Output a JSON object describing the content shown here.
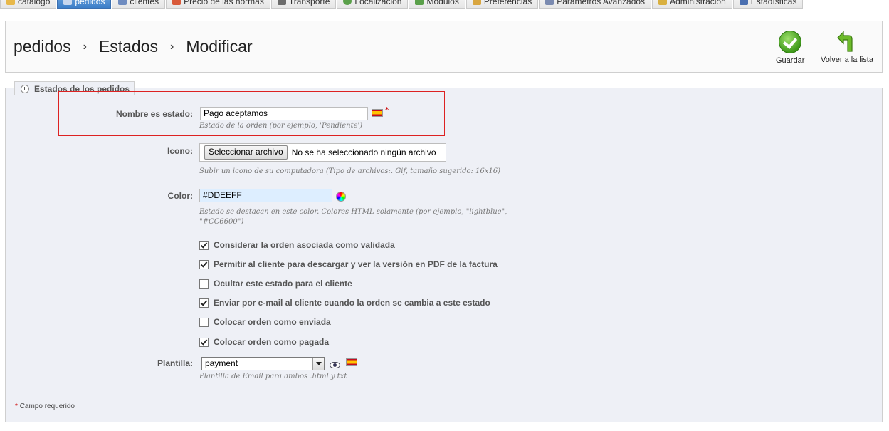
{
  "tabs": [
    {
      "label": "catálogo",
      "icon": "folder-icon",
      "color": "#e8b84a",
      "active": false
    },
    {
      "label": "pedidos",
      "icon": "cart-icon",
      "color": "#c8d7ee",
      "active": true
    },
    {
      "label": "clientes",
      "icon": "users-icon",
      "color": "#6f8cc0",
      "active": false
    },
    {
      "label": "Precio de las normas",
      "icon": "price-tag-icon",
      "color": "#d95a3a",
      "active": false
    },
    {
      "label": "Transporte",
      "icon": "truck-icon",
      "color": "#6b6b6b",
      "active": false
    },
    {
      "label": "Localización",
      "icon": "globe-icon",
      "color": "#5aa04a",
      "active": false
    },
    {
      "label": "Módulos",
      "icon": "puzzle-icon",
      "color": "#5aa04a",
      "active": false
    },
    {
      "label": "Preferencias",
      "icon": "preferences-icon",
      "color": "#d9a640",
      "active": false
    },
    {
      "label": "Parámetros Avanzados",
      "icon": "wrench-icon",
      "color": "#7a8ab0",
      "active": false
    },
    {
      "label": "Administración",
      "icon": "key-icon",
      "color": "#d9b040",
      "active": false
    },
    {
      "label": "Estadísticas",
      "icon": "stats-icon",
      "color": "#4a6fb0",
      "active": false
    }
  ],
  "breadcrumb": {
    "items": [
      "pedidos",
      "Estados",
      "Modificar"
    ],
    "separator": "›"
  },
  "toolbar": {
    "save_label": "Guardar",
    "back_label": "Volver a la lista"
  },
  "form": {
    "legend": "Estados de los pedidos",
    "name": {
      "label": "Nombre es estado:",
      "value": "Pago aceptamos",
      "required_mark": "*",
      "hint": "Estado de la orden (por ejemplo, 'Pendiente')"
    },
    "icon": {
      "label": "Icono:",
      "button_label": "Seleccionar archivo",
      "file_status": "No se ha seleccionado ningún archivo",
      "hint": "Subir un icono de su computadora (Tipo de archivos:. Gif, tamaño sugerido: 16x16)"
    },
    "color": {
      "label": "Color:",
      "value": "#DDEEFF",
      "hint_line1": "Estado se destacan en este color. Colores HTML solamente (por ejemplo, \"lightblue\",",
      "hint_line2": "\"#CC6600\")"
    },
    "checkboxes": [
      {
        "label": "Considerar la orden asociada como validada",
        "checked": true
      },
      {
        "label": "Permitir al cliente para descargar y ver la versión en PDF de la factura",
        "checked": true
      },
      {
        "label": "Ocultar este estado para el cliente",
        "checked": false
      },
      {
        "label": "Enviar por e-mail al cliente cuando la orden se cambia a este estado",
        "checked": true
      },
      {
        "label": "Colocar orden como enviada",
        "checked": false
      },
      {
        "label": "Colocar orden como pagada",
        "checked": true
      }
    ],
    "template": {
      "label": "Plantilla:",
      "selected": "payment",
      "hint": "Plantilla de Email para ambos .html y txt"
    },
    "required_note_star": "*",
    "required_note": "Campo requerido"
  },
  "colors": {
    "highlight_border": "#dd2222",
    "fieldset_bg": "#eef0f6",
    "active_tab": "#3d7fc9"
  }
}
